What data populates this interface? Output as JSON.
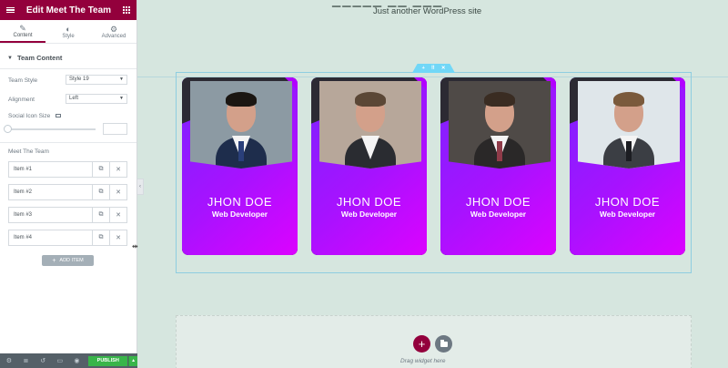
{
  "panel": {
    "title": "Edit Meet The Team",
    "tabs": [
      {
        "label": "Content",
        "icon": "pencil-icon"
      },
      {
        "label": "Style",
        "icon": "half-circle-icon"
      },
      {
        "label": "Advanced",
        "icon": "gear-icon"
      }
    ],
    "section_title": "Team Content",
    "team_style": {
      "label": "Team Style",
      "value": "Style 19"
    },
    "alignment": {
      "label": "Alignment",
      "value": "Left"
    },
    "social_icon_size": {
      "label": "Social Icon Size"
    },
    "repeater": {
      "label": "Meet The Team",
      "items": [
        "Item #1",
        "Item #2",
        "Item #3",
        "Item #4"
      ]
    },
    "add_item_label": "ADD ITEM",
    "publish_label": "PUBLISH"
  },
  "site": {
    "tagline": "Just another WordPress site"
  },
  "cards": [
    {
      "name": "JHON DOE",
      "role": "Web Developer",
      "bg": "#8c9aa3",
      "suit": "#1e2d4c",
      "tie": "#2a3f7a",
      "hair": "#1b1612"
    },
    {
      "name": "JHON DOE",
      "role": "Web Developer",
      "bg": "#b7a79a",
      "suit": "#2a2c31",
      "tie": "#f4f4f4",
      "hair": "#5b4736"
    },
    {
      "name": "JHON DOE",
      "role": "Web Developer",
      "bg": "#4f4a47",
      "suit": "#2a2828",
      "tie": "#8f3b49",
      "hair": "#3a2c22"
    },
    {
      "name": "JHON DOE",
      "role": "Web Developer",
      "bg": "#dfe6ea",
      "suit": "#3b3e44",
      "tie": "#1c1d22",
      "hair": "#7a5a3c"
    }
  ],
  "dropzone": {
    "text": "Drag widget here"
  },
  "colors": {
    "brand": "#93003c",
    "card_start": "#7e24ff",
    "card_end": "#df00ff",
    "publish": "#39b54a"
  }
}
